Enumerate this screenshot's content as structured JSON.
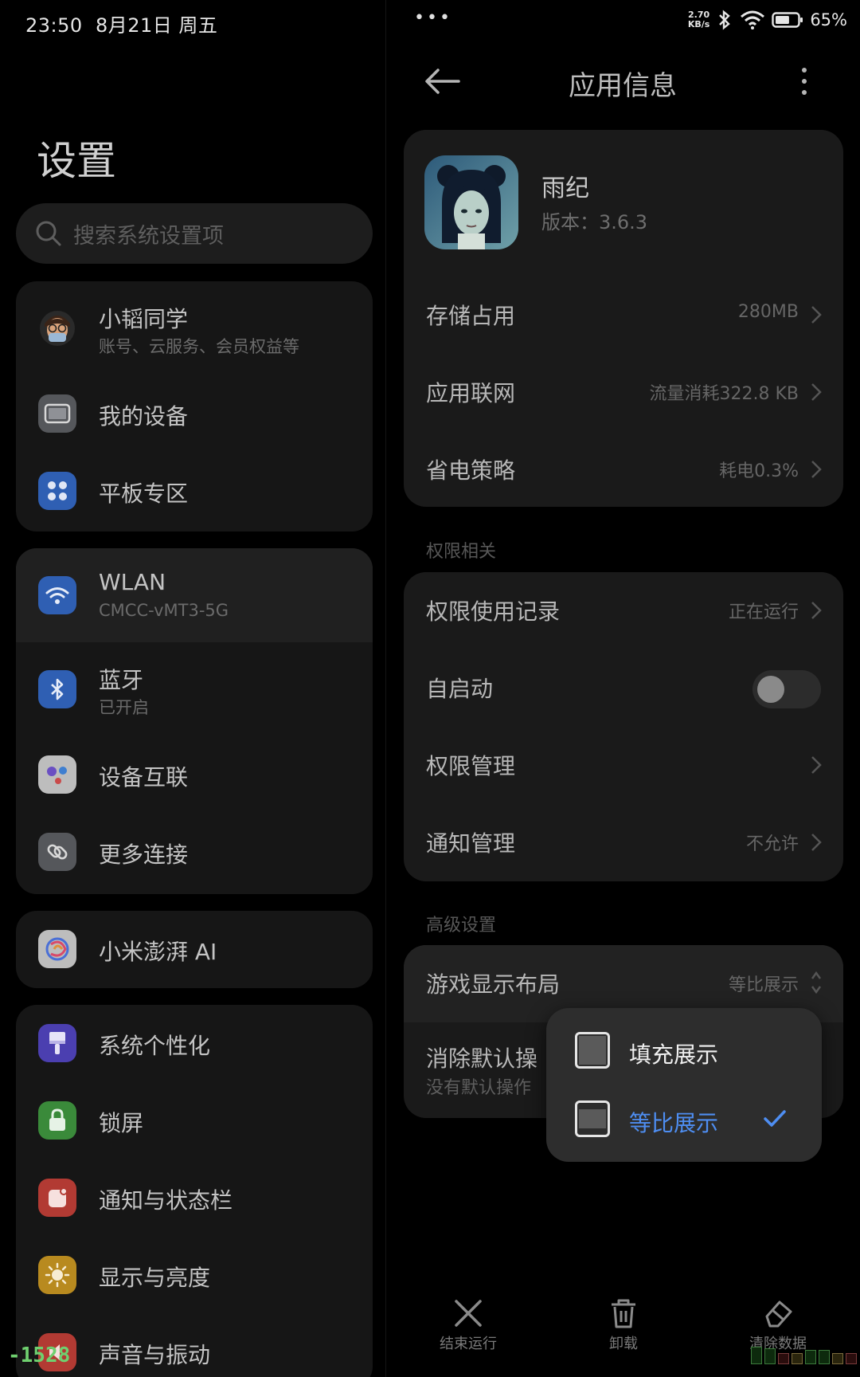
{
  "status_bar": {
    "time": "23:50",
    "date": "8月21日 周五",
    "more_dots": "•••",
    "net_speed_value": "2.70",
    "net_speed_unit": "KB/s",
    "battery_percent": "65%",
    "battery_level": 0.65
  },
  "settings": {
    "title": "设置",
    "search_placeholder": "搜索系统设置项",
    "account": {
      "name": "小韬同学",
      "subtitle": "账号、云服务、会员权益等"
    },
    "group1": [
      {
        "label": "我的设备",
        "icon": "tablet-icon",
        "color": "#55575b"
      },
      {
        "label": "平板专区",
        "icon": "grid-dots-icon",
        "color": "#2f5fb3"
      }
    ],
    "group2": [
      {
        "label": "WLAN",
        "sub": "CMCC-vMT3-5G",
        "icon": "wifi-icon",
        "color": "#2f5fb3"
      },
      {
        "label": "蓝牙",
        "sub": "已开启",
        "icon": "bluetooth-icon",
        "color": "#2f5fb3"
      },
      {
        "label": "设备互联",
        "icon": "device-link-icon",
        "color": "#bdbdbd"
      },
      {
        "label": "更多连接",
        "icon": "link-icon",
        "color": "#55575b"
      }
    ],
    "group3": [
      {
        "label": "小米澎湃 AI",
        "icon": "hyperai-icon",
        "color": "#bdbdbd"
      }
    ],
    "group4": [
      {
        "label": "系统个性化",
        "icon": "brush-icon",
        "color": "#4b3fb0"
      },
      {
        "label": "锁屏",
        "icon": "lock-icon",
        "color": "#3a8a3a"
      },
      {
        "label": "通知与状态栏",
        "icon": "notification-icon",
        "color": "#b23a33"
      },
      {
        "label": "显示与亮度",
        "icon": "sun-icon",
        "color": "#b88a1f"
      },
      {
        "label": "声音与振动",
        "icon": "speaker-icon",
        "color": "#b23a33"
      }
    ]
  },
  "app_info": {
    "title": "应用信息",
    "app_name": "雨纪",
    "version": "版本：3.6.3",
    "rows": [
      {
        "label": "存储占用",
        "value": "280MB"
      },
      {
        "label": "应用联网",
        "value": "流量消耗322.8 KB"
      },
      {
        "label": "省电策略",
        "value": "耗电0.3%"
      }
    ],
    "permission_section": "权限相关",
    "permission_rows": [
      {
        "label": "权限使用记录",
        "value": "正在运行"
      },
      {
        "label": "自启动",
        "toggle": false
      },
      {
        "label": "权限管理",
        "value": ""
      },
      {
        "label": "通知管理",
        "value": "不允许"
      }
    ],
    "advanced_section": "高级设置",
    "advanced_rows": [
      {
        "label": "游戏显示布局",
        "value": "等比展示"
      },
      {
        "label": "消除默认操",
        "sub": "没有默认操作"
      }
    ]
  },
  "layout_popup": {
    "options": [
      {
        "label": "填充展示",
        "selected": false
      },
      {
        "label": "等比展示",
        "selected": true
      }
    ]
  },
  "bottom_actions": [
    {
      "label": "结束运行",
      "icon": "close-icon"
    },
    {
      "label": "卸载",
      "icon": "trash-icon"
    },
    {
      "label": "清除数据",
      "icon": "eraser-icon"
    }
  ],
  "overlay": {
    "debug_number": "-1528"
  }
}
